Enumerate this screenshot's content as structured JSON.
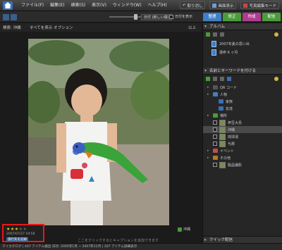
{
  "menu": [
    "ファイル(F)",
    "編集(E)",
    "検索(S)",
    "表示(V)",
    "ウィンドウ(W)",
    "ヘルプ(H)"
  ],
  "topbar": {
    "undo_label": "取り消し",
    "monitor_label": "画面表示",
    "editor_label": "写真編集モード"
  },
  "tabs": [
    "整理",
    "修正",
    "作成",
    "配信"
  ],
  "toolbar": {
    "sort_value": "日付 (新しい順)",
    "show_label": "日付を表示"
  },
  "browse": {
    "crumb": "検索: 沖縄",
    "show_all": "すべてを表示",
    "options": "オプション",
    "right_label": "以上"
  },
  "viewer": {
    "caption_hint": "ここをクリックするとキャプションを追加できます",
    "tag_badge": "沖縄"
  },
  "meta": {
    "stars_on": "★★★",
    "stars_off": "★★",
    "date": "2007/07/27 19:58",
    "tag": "旅行先を記録"
  },
  "status": "マイカタログ | 447 アイテム検出 日付: 2005年1月 ~ 2007年12月 | 307 アイテム詳細表示",
  "panel": {
    "album_head": "アルバム",
    "albums": [
      "2007年夏の思い出",
      "運命 6 ヶ月"
    ],
    "keyword_head": "名前とキーワードを付ける",
    "keywords": [
      {
        "label": "QR コード",
        "indent": 1,
        "kind": "none"
      },
      {
        "label": "人物",
        "indent": 1,
        "kind": "people"
      },
      {
        "label": "家族",
        "indent": 2,
        "kind": "people2"
      },
      {
        "label": "友達",
        "indent": 2,
        "kind": "people2"
      },
      {
        "label": "場所",
        "indent": 1,
        "kind": "place"
      },
      {
        "label": "伊豆大島",
        "indent": 2,
        "kind": "thumb"
      },
      {
        "label": "沖縄",
        "indent": 2,
        "kind": "thumb",
        "selected": true
      },
      {
        "label": "琉球湯",
        "indent": 2,
        "kind": "thumb"
      },
      {
        "label": "与那",
        "indent": 2,
        "kind": "thumb"
      },
      {
        "label": "イベント",
        "indent": 1,
        "kind": "event"
      },
      {
        "label": "その他",
        "indent": 1,
        "kind": "other"
      },
      {
        "label": "製品撮影",
        "indent": 2,
        "kind": "thumb"
      }
    ],
    "bottom_head": "クイック配信"
  },
  "colors": {
    "accent_blue": "#3f7fc5",
    "highlight_red": "#e8181c",
    "star_yellow": "#f2c21b"
  }
}
